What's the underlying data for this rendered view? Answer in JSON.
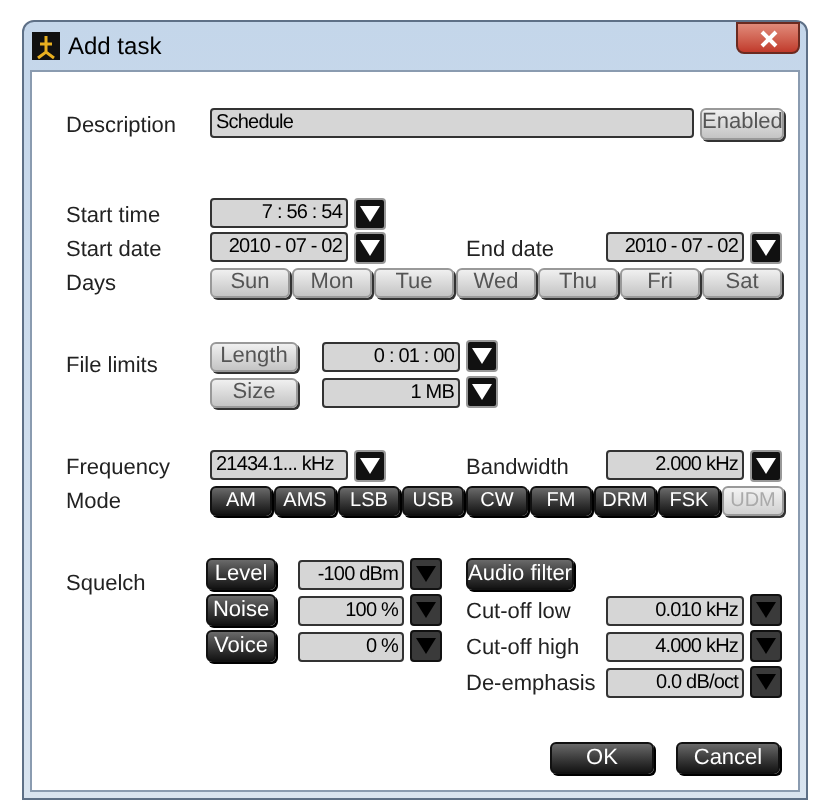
{
  "window": {
    "title": "Add task"
  },
  "description": {
    "label": "Description",
    "value": "Schedule",
    "button": "Enabled"
  },
  "start_time": {
    "label": "Start time",
    "value": "7 : 56 : 54"
  },
  "start_date": {
    "label": "Start date",
    "value": "2010 - 07 - 02"
  },
  "end_date": {
    "label": "End date",
    "value": "2010 - 07 - 02"
  },
  "days": {
    "label": "Days",
    "items": [
      {
        "label": "Sun",
        "selected": false
      },
      {
        "label": "Mon",
        "selected": false
      },
      {
        "label": "Tue",
        "selected": false
      },
      {
        "label": "Wed",
        "selected": false
      },
      {
        "label": "Thu",
        "selected": false
      },
      {
        "label": "Fri",
        "selected": false
      },
      {
        "label": "Sat",
        "selected": false
      }
    ]
  },
  "file_limits": {
    "label": "File limits",
    "rows": [
      {
        "button": "Length",
        "value": "0 : 01 : 00"
      },
      {
        "button": "Size",
        "value": "1 MB"
      }
    ]
  },
  "frequency": {
    "label": "Frequency",
    "value": "21434.1... kHz"
  },
  "bandwidth": {
    "label": "Bandwidth",
    "value": "2.000 kHz"
  },
  "mode": {
    "label": "Mode",
    "items": [
      {
        "label": "AM",
        "disabled": false
      },
      {
        "label": "AMS",
        "disabled": false
      },
      {
        "label": "LSB",
        "disabled": false
      },
      {
        "label": "USB",
        "disabled": false
      },
      {
        "label": "CW",
        "disabled": false
      },
      {
        "label": "FM",
        "disabled": false
      },
      {
        "label": "DRM",
        "disabled": false
      },
      {
        "label": "FSK",
        "disabled": false
      },
      {
        "label": "UDM",
        "disabled": true
      }
    ]
  },
  "squelch": {
    "label": "Squelch",
    "rows": [
      {
        "button": "Level",
        "value": "-100 dBm"
      },
      {
        "button": "Noise",
        "value": "100 %"
      },
      {
        "button": "Voice",
        "value": "0 %"
      }
    ]
  },
  "audio_filter": {
    "button": "Audio filter",
    "rows": [
      {
        "label": "Cut-off low",
        "value": "0.010 kHz"
      },
      {
        "label": "Cut-off high",
        "value": "4.000 kHz"
      },
      {
        "label": "De-emphasis",
        "value": "0.0 dB/oct"
      }
    ]
  },
  "buttons": [
    {
      "label": "OK"
    },
    {
      "label": "Cancel"
    }
  ]
}
